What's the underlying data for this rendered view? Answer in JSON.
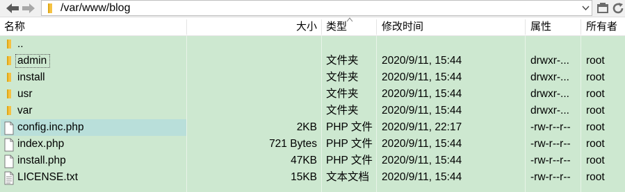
{
  "toolbar": {
    "path": "/var/www/blog",
    "icons": [
      "back-arrow-icon",
      "forward-arrow-icon",
      "folder-icon",
      "chevron-down-icon",
      "open-folder-icon",
      "refresh-icon"
    ]
  },
  "columns": {
    "name": "名称",
    "size": "大小",
    "type": "类型",
    "modified": "修改时间",
    "permissions": "属性",
    "owner": "所有者"
  },
  "files": [
    {
      "name": "..",
      "size": "",
      "type": "",
      "modified": "",
      "permissions": "",
      "owner": "",
      "kind": "folder"
    },
    {
      "name": "admin",
      "size": "",
      "type": "文件夹",
      "modified": "2020/9/11, 15:44",
      "permissions": "drwxr-...",
      "owner": "root",
      "kind": "folder"
    },
    {
      "name": "install",
      "size": "",
      "type": "文件夹",
      "modified": "2020/9/11, 15:44",
      "permissions": "drwxr-...",
      "owner": "root",
      "kind": "folder"
    },
    {
      "name": "usr",
      "size": "",
      "type": "文件夹",
      "modified": "2020/9/11, 15:44",
      "permissions": "drwxr-...",
      "owner": "root",
      "kind": "folder"
    },
    {
      "name": "var",
      "size": "",
      "type": "文件夹",
      "modified": "2020/9/11, 15:44",
      "permissions": "drwxr-...",
      "owner": "root",
      "kind": "folder"
    },
    {
      "name": "config.inc.php",
      "size": "2KB",
      "type": "PHP 文件",
      "modified": "2020/9/11, 22:17",
      "permissions": "-rw-r--r--",
      "owner": "root",
      "kind": "file",
      "selected": true
    },
    {
      "name": "index.php",
      "size": "721 Bytes",
      "type": "PHP 文件",
      "modified": "2020/9/11, 15:44",
      "permissions": "-rw-r--r--",
      "owner": "root",
      "kind": "file"
    },
    {
      "name": "install.php",
      "size": "47KB",
      "type": "PHP 文件",
      "modified": "2020/9/11, 15:44",
      "permissions": "-rw-r--r--",
      "owner": "root",
      "kind": "file"
    },
    {
      "name": "LICENSE.txt",
      "size": "15KB",
      "type": "文本文档",
      "modified": "2020/9/11, 15:44",
      "permissions": "-rw-r--r--",
      "owner": "root",
      "kind": "text"
    }
  ],
  "colors": {
    "list_background": "#cde8d0",
    "selection": "#b9dfda",
    "folder": "#f5c242"
  }
}
